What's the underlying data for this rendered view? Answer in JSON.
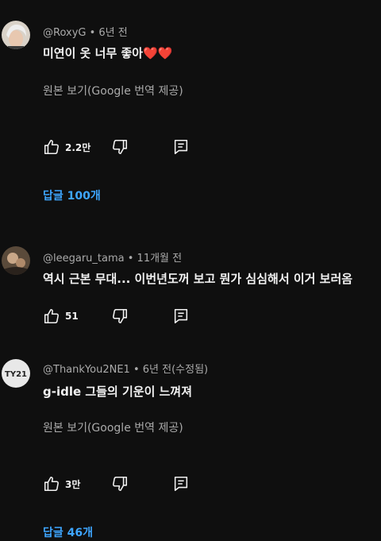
{
  "comments": [
    {
      "author": "@RoxyG",
      "time": "6년 전",
      "text": "미연이 옷 너무 좋아",
      "emoji": "❤️❤️",
      "translate": "원본 보기(Google 번역 제공)",
      "likes": "2.2만",
      "replies": "답글 100개"
    },
    {
      "author": "@leegaru_tama",
      "time": "11개월 전",
      "text": "역시 근본 무대... 이번년도꺼 보고 뭔가 심심해서 이거 보러옴",
      "likes": "51"
    },
    {
      "author": "@ThankYou2NE1",
      "time": "6년 전(수정됨)",
      "avatar_text": "TY21",
      "text": "g-idle 그들의 기운이 느껴져",
      "translate": "원본 보기(Google 번역 제공)",
      "likes": "3만",
      "replies": "답글 46개"
    }
  ],
  "separator": " • ",
  "colors": {
    "background": "#0f0f0f",
    "text": "#f1f1f1",
    "secondary": "#aaaaaa",
    "link": "#3ea6ff",
    "heart": "#ff4d7a"
  },
  "icons": [
    "like-icon",
    "dislike-icon",
    "reply-icon"
  ]
}
